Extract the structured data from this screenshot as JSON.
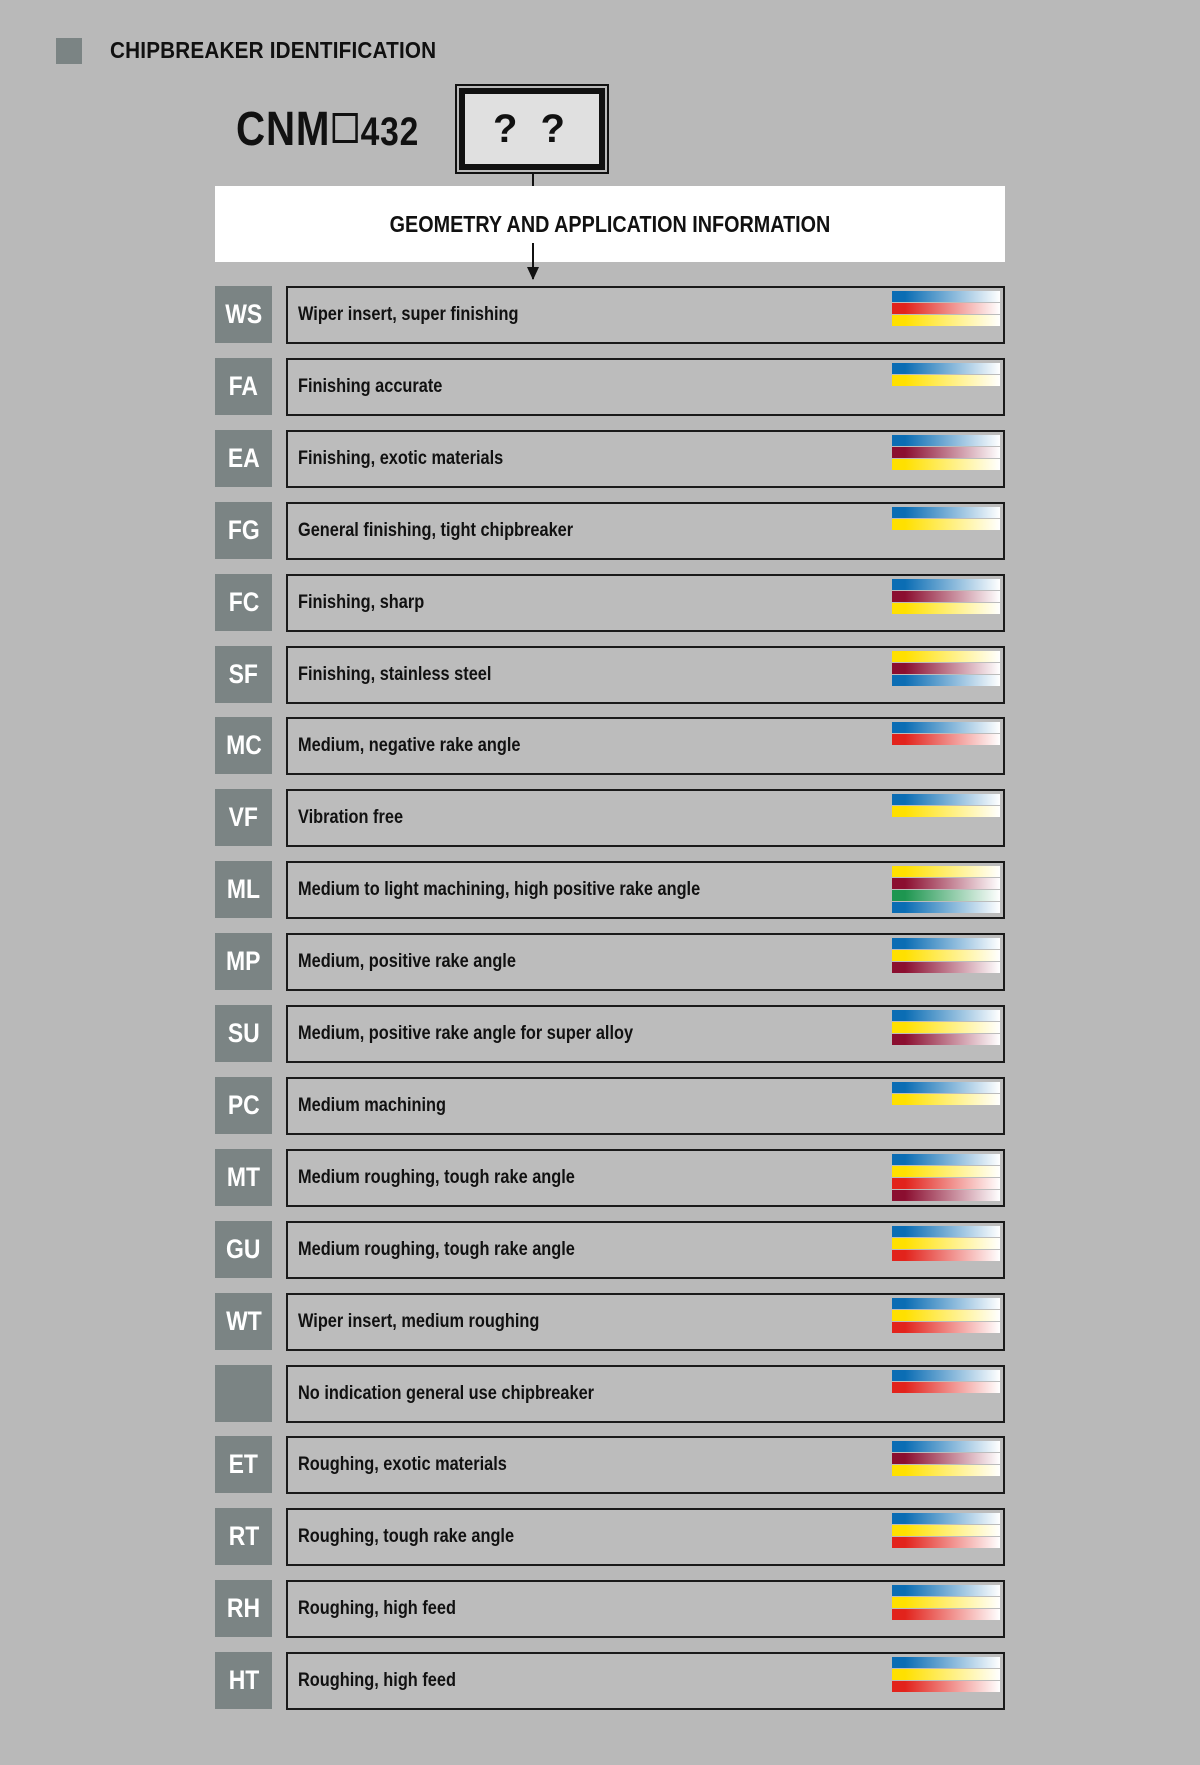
{
  "header": {
    "title": "CHIPBREAKER IDENTIFICATION"
  },
  "designation": {
    "prefix": "CNM",
    "suffix": "432",
    "chipbreaker_placeholder": "? ?"
  },
  "info_band": {
    "title": "GEOMETRY AND APPLICATION INFORMATION"
  },
  "material_colors": {
    "blue": "#0b6db4",
    "red": "#e2231c",
    "yellow": "#ffe000",
    "maroon": "#8b0e30",
    "green": "#1e9650"
  },
  "rows": [
    {
      "code": "WS",
      "description": "Wiper insert, super finishing",
      "materials": [
        "blue",
        "red",
        "yellow"
      ]
    },
    {
      "code": "FA",
      "description": "Finishing accurate",
      "materials": [
        "blue",
        "yellow"
      ]
    },
    {
      "code": "EA",
      "description": "Finishing, exotic materials",
      "materials": [
        "blue",
        "maroon",
        "yellow"
      ]
    },
    {
      "code": "FG",
      "description": "General finishing, tight chipbreaker",
      "materials": [
        "blue",
        "yellow"
      ]
    },
    {
      "code": "FC",
      "description": "Finishing, sharp",
      "materials": [
        "blue",
        "maroon",
        "yellow"
      ]
    },
    {
      "code": "SF",
      "description": "Finishing, stainless steel",
      "materials": [
        "yellow",
        "maroon",
        "blue"
      ]
    },
    {
      "code": "MC",
      "description": "Medium, negative rake angle",
      "materials": [
        "blue",
        "red"
      ]
    },
    {
      "code": "VF",
      "description": "Vibration free",
      "materials": [
        "blue",
        "yellow"
      ]
    },
    {
      "code": "ML",
      "description": "Medium to light machining, high positive rake angle",
      "materials": [
        "yellow",
        "maroon",
        "green",
        "blue"
      ]
    },
    {
      "code": "MP",
      "description": "Medium, positive rake angle",
      "materials": [
        "blue",
        "yellow",
        "maroon"
      ]
    },
    {
      "code": "SU",
      "description": "Medium, positive rake angle for super alloy",
      "materials": [
        "blue",
        "yellow",
        "maroon"
      ]
    },
    {
      "code": "PC",
      "description": "Medium machining",
      "materials": [
        "blue",
        "yellow"
      ]
    },
    {
      "code": "MT",
      "description": "Medium roughing, tough rake angle",
      "materials": [
        "blue",
        "yellow",
        "red",
        "maroon"
      ]
    },
    {
      "code": "GU",
      "description": "Medium roughing, tough rake angle",
      "materials": [
        "blue",
        "yellow",
        "red"
      ]
    },
    {
      "code": "WT",
      "description": "Wiper insert, medium roughing",
      "materials": [
        "blue",
        "yellow",
        "red"
      ]
    },
    {
      "code": "",
      "description": "No indication general use chipbreaker",
      "materials": [
        "blue",
        "red"
      ]
    },
    {
      "code": "ET",
      "description": "Roughing, exotic materials",
      "materials": [
        "blue",
        "maroon",
        "yellow"
      ]
    },
    {
      "code": "RT",
      "description": "Roughing, tough rake angle",
      "materials": [
        "blue",
        "yellow",
        "red"
      ]
    },
    {
      "code": "RH",
      "description": "Roughing, high feed",
      "materials": [
        "blue",
        "yellow",
        "red"
      ]
    },
    {
      "code": "HT",
      "description": "Roughing, high feed",
      "materials": [
        "blue",
        "yellow",
        "red"
      ]
    }
  ]
}
